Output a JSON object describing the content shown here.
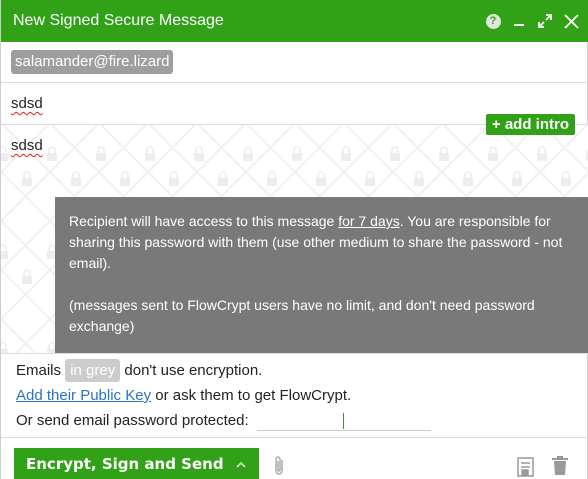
{
  "header": {
    "title": "New Signed Secure Message",
    "help_label": "?"
  },
  "recipients": {
    "chips": [
      "salamander@fire.lizard"
    ]
  },
  "subject": {
    "value": "sdsd"
  },
  "body": {
    "text": "sdsd",
    "add_intro_label": "+ add intro"
  },
  "notice": {
    "line1_before": "Recipient will have access to this message ",
    "line1_link": "for 7 days",
    "line1_after": ". You are responsible for sharing this password with them (use other medium to share the password - not email).",
    "line2": "(messages sent to FlowCrypt users have no limit, and don't need password exchange)"
  },
  "warnings": {
    "emails_label": "Emails",
    "in_grey": "in grey",
    "no_encryption": "don't use encryption.",
    "add_pubkey_link": "Add their Public Key",
    "or_ask": "or ask them to get FlowCrypt.",
    "password_label": "Or send email password protected:"
  },
  "footer": {
    "send_label": "Encrypt, Sign and Send"
  },
  "colors": {
    "brand_green": "#31a217",
    "chip_grey": "#9e9e9e",
    "link_blue": "#2a73c8",
    "notice_bg": "#6e6e6e"
  },
  "icons": [
    "help-icon",
    "minimize-icon",
    "fullscreen-icon",
    "close-icon",
    "chevron-up-icon",
    "paperclip-icon",
    "document-icon",
    "trash-icon",
    "lock-icon"
  ]
}
